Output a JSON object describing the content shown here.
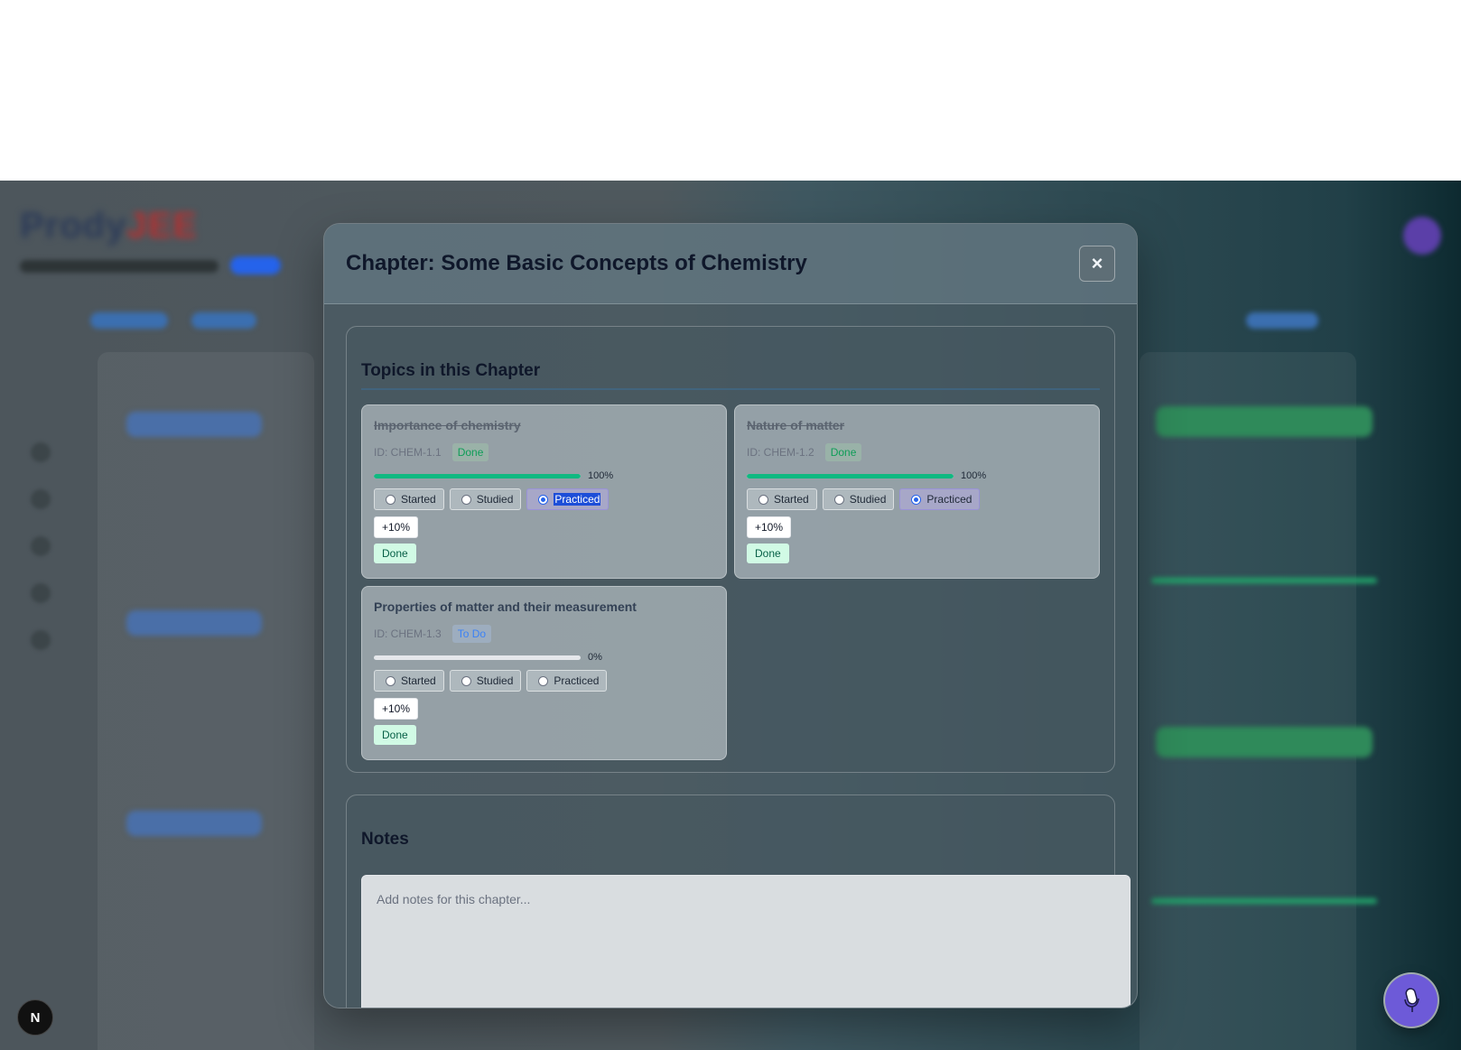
{
  "modal": {
    "title": "Chapter: Some Basic Concepts of Chemistry",
    "close_label": "×"
  },
  "topics_section": {
    "heading": "Topics in this Chapter",
    "topics": [
      {
        "name": "Importance of chemistry",
        "id_text": "ID: CHEM-1.1",
        "status": "Done",
        "progress": 100,
        "progress_label": "100%",
        "options": [
          "Started",
          "Studied",
          "Practiced"
        ],
        "selected_option": "Practiced",
        "increment_label": "+10%",
        "done_label": "Done"
      },
      {
        "name": "Nature of matter",
        "id_text": "ID: CHEM-1.2",
        "status": "Done",
        "progress": 100,
        "progress_label": "100%",
        "options": [
          "Started",
          "Studied",
          "Practiced"
        ],
        "selected_option": "Practiced",
        "increment_label": "+10%",
        "done_label": "Done"
      },
      {
        "name": "Properties of matter and their measurement",
        "id_text": "ID: CHEM-1.3",
        "status": "To Do",
        "progress": 0,
        "progress_label": "0%",
        "options": [
          "Started",
          "Studied",
          "Practiced"
        ],
        "selected_option": "",
        "increment_label": "+10%",
        "done_label": "Done"
      }
    ]
  },
  "notes_section": {
    "heading": "Notes",
    "placeholder": "Add notes for this chapter..."
  },
  "floating": {
    "next_badge": "N"
  },
  "colors": {
    "progress_fill": "#10b981",
    "done_text": "#0f9d58",
    "todo_text": "#3b82f6",
    "mic_button": "#6d5ad8"
  }
}
